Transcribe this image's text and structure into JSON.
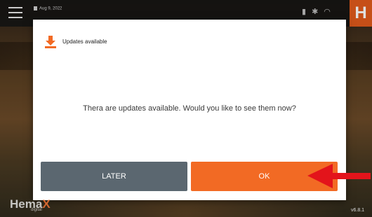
{
  "topbar": {
    "date": "Aug 9, 2022",
    "status_icons": [
      "battery-icon",
      "settings-icon",
      "wifi-icon"
    ],
    "brand_letter": "H"
  },
  "dialog": {
    "title": "Updates available",
    "message": "Thera are updates available. Would you like to see them now?",
    "later_label": "LATER",
    "ok_label": "OK"
  },
  "brand": {
    "logo_main": "Hema",
    "logo_x": "X",
    "logo_sub": "digital",
    "version": "v6.8.1"
  },
  "colors": {
    "accent": "#f26a24",
    "later_button": "#5b6770",
    "annotation_arrow": "#e3141b"
  }
}
